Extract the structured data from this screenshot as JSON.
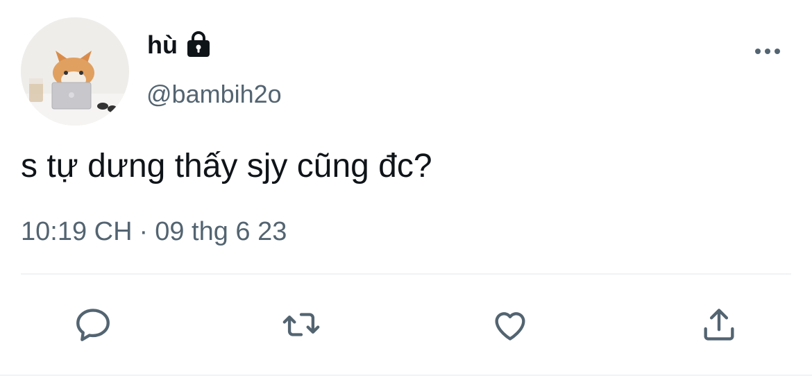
{
  "tweet": {
    "author": {
      "display_name": "hù",
      "handle": "@bambih2o",
      "protected_icon": "lock-icon",
      "avatar": "cat-photo-avatar"
    },
    "text": "s tự dưng thấy sjy cũng đc?",
    "meta": {
      "time": "10:19 CH",
      "separator": "·",
      "date": "09 thg 6 23"
    },
    "more_icon": "more-horizontal-icon"
  },
  "actions": [
    {
      "name": "reply",
      "icon": "reply-bubble-icon"
    },
    {
      "name": "retweet",
      "icon": "retweet-arrows-icon"
    },
    {
      "name": "like",
      "icon": "heart-icon"
    },
    {
      "name": "share",
      "icon": "share-upload-icon"
    }
  ],
  "colors": {
    "text_primary": "#0f1419",
    "text_secondary": "#536471",
    "divider": "#eff3f4"
  }
}
